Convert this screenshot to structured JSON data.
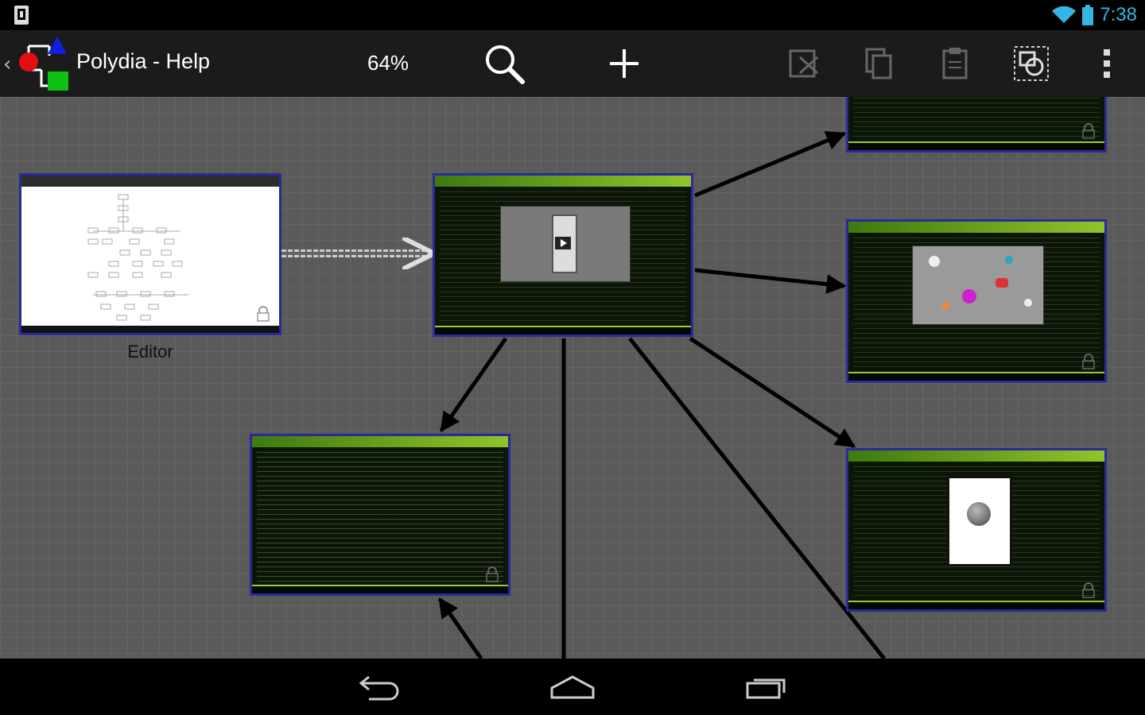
{
  "status_bar": {
    "time": "7:38",
    "icons": [
      "phone-icon",
      "wifi-icon",
      "battery-icon"
    ],
    "time_color": "#33b5e5"
  },
  "action_bar": {
    "title": "Polydia - Help",
    "zoom": "64%",
    "buttons": [
      "search-icon",
      "add-icon",
      "cut-icon",
      "copy-icon",
      "paste-icon",
      "select-icon",
      "overflow-menu-icon"
    ]
  },
  "diagram": {
    "nodes": [
      {
        "id": "editor",
        "label": "Editor"
      },
      {
        "id": "help-main",
        "label": ""
      },
      {
        "id": "help-top-right",
        "label": ""
      },
      {
        "id": "help-visualizer",
        "label": ""
      },
      {
        "id": "help-text",
        "label": ""
      },
      {
        "id": "help-device",
        "label": ""
      }
    ],
    "grid_color": "#5a5a5a",
    "node_border_color": "#2a2a9a"
  },
  "nav_bar": {
    "buttons": [
      "back-icon",
      "home-icon",
      "recent-apps-icon"
    ]
  }
}
